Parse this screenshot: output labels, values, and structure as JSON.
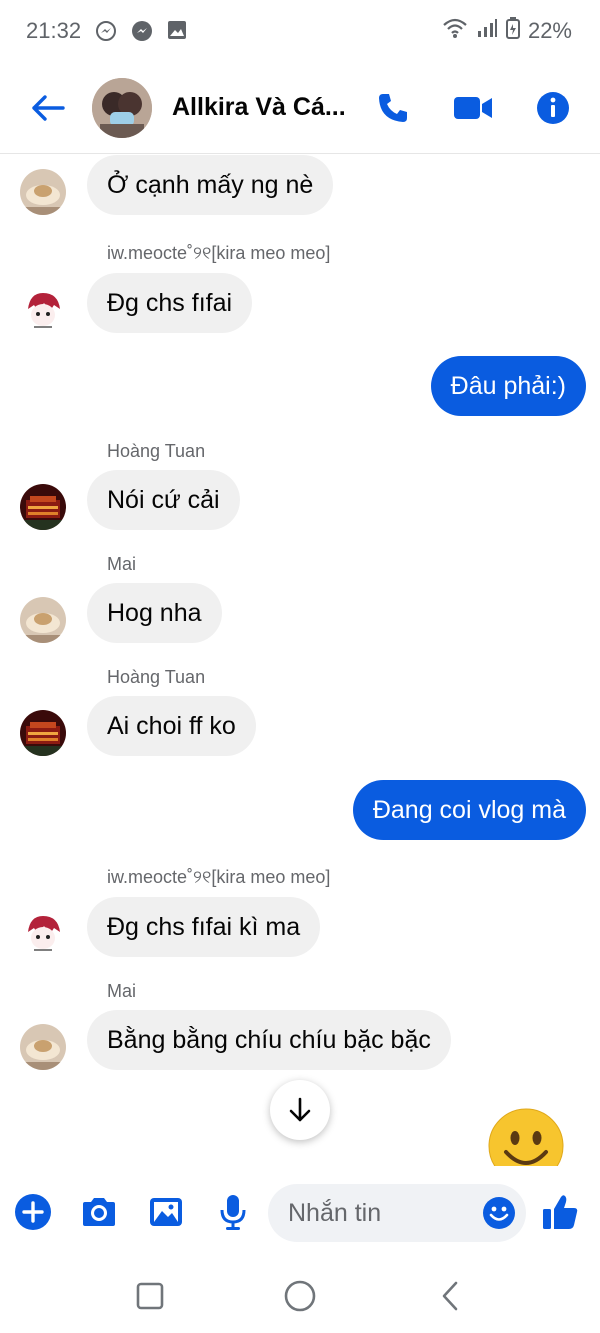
{
  "status_bar": {
    "time": "21:32",
    "battery": "22%",
    "notification_icons": [
      "messenger-icon",
      "messenger-icon",
      "gallery-icon"
    ]
  },
  "header": {
    "title": "Allkira Và Cá...",
    "actions": [
      "back-arrow-icon",
      "phone-icon",
      "video-camera-icon",
      "info-icon"
    ]
  },
  "colors": {
    "accent": "#0a5ce0",
    "incoming_bubble": "#f0f0f0",
    "text": "#050505",
    "secondary_text": "#65676b"
  },
  "messages": [
    {
      "direction": "in",
      "sender": "",
      "text": "Ở cạnh mấy ng nè",
      "avatar": "mai"
    },
    {
      "direction": "in",
      "sender": "iw.meocte˚୨୧[kira meo meo]",
      "text": "Đg chs fıfai",
      "avatar": "kira"
    },
    {
      "direction": "out",
      "sender": "",
      "text": "Đâu phải:)",
      "avatar": ""
    },
    {
      "direction": "in",
      "sender": "Hoàng Tuan",
      "text": "Nói cứ cải",
      "avatar": "hoang"
    },
    {
      "direction": "in",
      "sender": "Mai",
      "text": "Hog nha",
      "avatar": "mai"
    },
    {
      "direction": "in",
      "sender": "Hoàng Tuan",
      "text": "Ai choi ff ko",
      "avatar": "hoang"
    },
    {
      "direction": "out",
      "sender": "",
      "text": "Đang coi vlog mà",
      "avatar": ""
    },
    {
      "direction": "in",
      "sender": "iw.meocte˚୨୧[kira meo meo]",
      "text": "Đg chs fıfai kì ma",
      "avatar": "kira"
    },
    {
      "direction": "in",
      "sender": "Mai",
      "text": "Bằng bằng chíu chíu bặc bặc",
      "avatar": "mai"
    }
  ],
  "composer": {
    "placeholder": "Nhắn tin",
    "buttons": [
      "plus-icon",
      "camera-icon",
      "image-icon",
      "microphone-icon",
      "emoji-icon",
      "thumbs-up-icon"
    ]
  },
  "nav_bar": [
    "recents-icon",
    "home-icon",
    "back-icon"
  ]
}
